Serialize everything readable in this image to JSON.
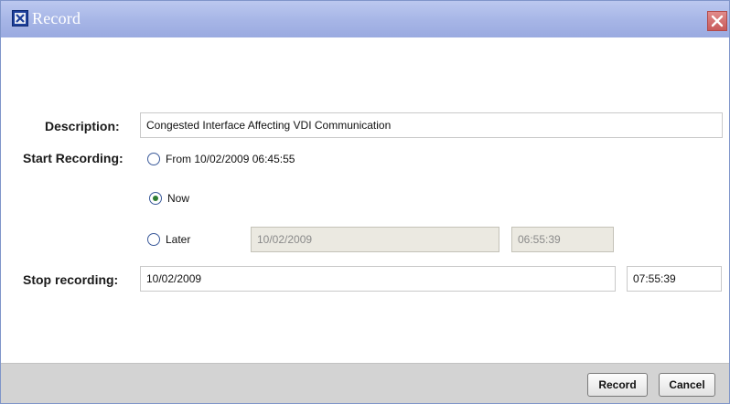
{
  "window": {
    "title": "Record",
    "app_icon": "app-x-icon",
    "close_icon": "close-icon"
  },
  "form": {
    "description_label": "Description:",
    "description_value": "Congested Interface Affecting VDI Communication",
    "start_label": "Start Recording:",
    "start_options": [
      {
        "label": "From 10/02/2009 06:45:55",
        "checked": false
      },
      {
        "label": "Now",
        "checked": true
      },
      {
        "label": "Later",
        "checked": false
      }
    ],
    "later_date": "10/02/2009",
    "later_time": "06:55:39",
    "stop_label": "Stop recording:",
    "stop_date": "10/02/2009",
    "stop_time": "07:55:39"
  },
  "buttons": {
    "record": "Record",
    "cancel": "Cancel"
  },
  "colors": {
    "titlebar": "#a6b5e6",
    "footer": "#d3d3d3",
    "radio_selected": "#2e7d32"
  }
}
